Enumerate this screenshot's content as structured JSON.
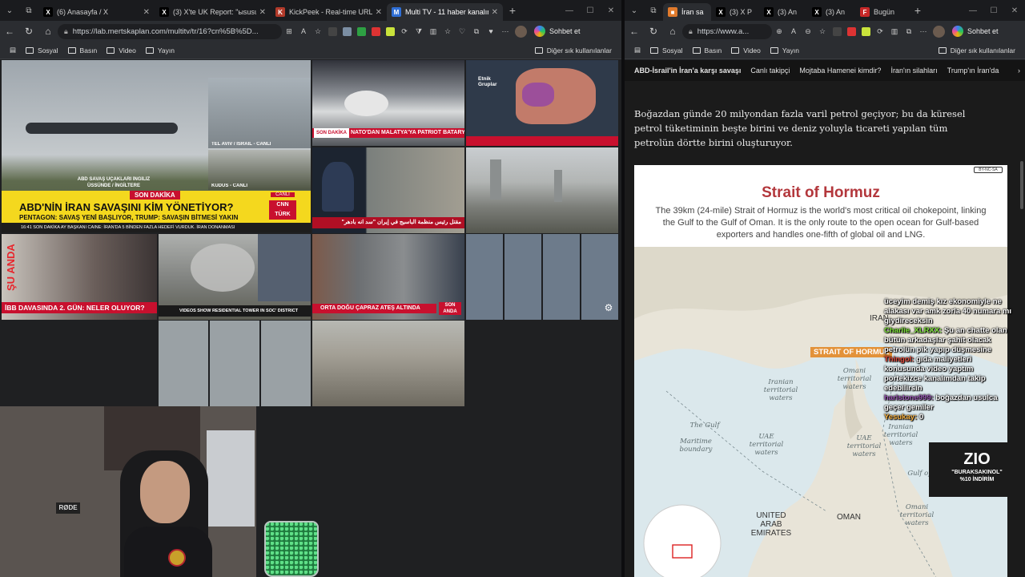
{
  "left_window": {
    "tabs": [
      {
        "label": "(6) Anasayfa / X",
        "favicon": "X",
        "favicon_color": "#000000"
      },
      {
        "label": "(3) X'te UK Report: \"ыsusu. — A",
        "favicon": "X",
        "favicon_color": "#000000"
      },
      {
        "label": "KickPeek - Real-time URL Cra",
        "favicon": "K",
        "favicon_color": "#b23a2a"
      },
      {
        "label": "Multi TV - 11 haber kanalını aynı",
        "favicon": "M",
        "favicon_color": "#2f6fd6",
        "active": true
      }
    ],
    "url": "https://lab.mertskaplan.com/multitv/tr/16?cn%5B%5D...",
    "bookmarks": [
      "Sosyal",
      "Basın",
      "Video",
      "Yayın"
    ],
    "bookmarks_right": "Diğer sık kullanılanlar",
    "tiles": {
      "t1_caption": "ABD SAVAŞ UÇAKLARI İNGİLİZ ÜSSÜNDE / İNGİLTERE",
      "t1_small1": "TEL AVIV / İSRAİL - CANLI",
      "t1_small2": "KUDÜS - CANLI",
      "son_dakika": "SON DAKİKA",
      "headline": "ABD'NİN İRAN SAVAŞINI KİM YÖNETİYOR?",
      "subheadline": "PENTAGON: SAVAŞ YENİ BAŞLIYOR, TRUMP: SAVAŞIN BİTMESİ YAKIN",
      "ticker": "16:41  SON DAKİKA    AY BAŞKANI CAINE: İRAN'DA 5 BİNDEN FAZLA HEDEFİ VURDUK. İRAN DONANMASI",
      "cnn_live": "CANLI",
      "cnn_logo": "CNN TÜRK",
      "ntv_banner": "NATO'DAN MALATYA'YA PATRIOT BATARYASI",
      "ntv_son": "SON DAKİKA",
      "ntv_map_label": "Etnik Gruplar",
      "arabic_caption": "مقتل رئيس منظمة الباسيج في إيران \"سد انه بادهر\"",
      "su_anda": "ŞU ANDA",
      "ibb_caption": "İBB DAVASINDA 2. GÜN: NELER OLUYOR?",
      "aljazeera_caption": "VIDEOS SHOW RESIDENTIAL TOWER IN SOC' DISTRICT",
      "ortadogu_caption": "ORTA DOĞU ÇAPRAZ ATEŞ ALTINDA",
      "son_anda": "SON ANDA"
    }
  },
  "right_window": {
    "tabs": [
      {
        "label": "İran sa",
        "favicon": "■",
        "favicon_color": "#e07a2c",
        "active": true
      },
      {
        "label": "(3) X P",
        "favicon": "X",
        "favicon_color": "#000000"
      },
      {
        "label": "(3) An",
        "favicon": "X",
        "favicon_color": "#000000"
      },
      {
        "label": "(3) An",
        "favicon": "X",
        "favicon_color": "#000000"
      },
      {
        "label": "Bugün",
        "favicon": "F",
        "favicon_color": "#c62828"
      }
    ],
    "url": "https://www.a...",
    "bookmarks": [
      "Sosyal",
      "Basın",
      "Video",
      "Yayın"
    ],
    "bookmarks_right": "Diğer sık kullanılanlar",
    "nav": [
      "ABD-İsrail'in İran'a karşı savaşı",
      "Canlı takipçi",
      "Mojtaba Hamenei kimdir?",
      "İran'ın silahları",
      "Trump'ın İran'da"
    ],
    "paragraph": "Boğazdan günde 20 milyondan fazla varil petrol geçiyor; bu da küresel petrol tüketiminin beşte birini ve deniz yoluyla ticareti yapılan tüm petrolün dörtte birini oluşturuyor.",
    "map": {
      "title": "Strait of Hormuz",
      "subtitle": "The 39km (24-mile) Strait of Hormuz is the world's most critical oil chokepoint, linking the Gulf to the Gulf of Oman. It is the only route to the open ocean for Gulf-based exporters and handles one-fifth of global oil and LNG.",
      "license": "BY-NC-SA",
      "labels": {
        "iran": "IRAN",
        "strait": "STRAIT OF HORMUZ",
        "iranian_waters": "Iranian territorial waters",
        "omani_waters_top": "Omani territorial waters",
        "the_gulf": "The Gulf",
        "maritime": "Maritime boundary",
        "uae_waters": "UAE territorial waters",
        "iranian_waters_2": "Iranian territorial waters",
        "uae_waters_2": "UAE territorial waters",
        "gulf_of_oman": "Gulf of Oman",
        "uae": "UNITED ARAB EMIRATES",
        "oman": "OMAN",
        "omani_waters": "Omani territorial waters"
      }
    },
    "chat": [
      {
        "user": "",
        "text": "üceyim demiş kız ekonomiyle ne alakası var amk zorla 40 numara mı giydireceksin"
      },
      {
        "user": "Charlie_XLRXX:",
        "text": "Şu an chatte olan bütün arkadaşlar şahit olacak petrolün pik yapıp düşmesine"
      },
      {
        "user": "Thingol:",
        "text": "gıda maliyetleri konusunda video yaptım portekizce kanalımdan takip edebilirsin"
      },
      {
        "user": "harlstone999:",
        "text": "boğazdan usulca geçer gemiler"
      },
      {
        "user": "Yesukay:",
        "text": "0"
      }
    ],
    "overlay_logo": {
      "brand": "ZIO",
      "line1": "\"BURAKSAKINOL\"",
      "line2": "%10 İNDİRİM"
    }
  },
  "colors": {
    "red": "#c8102e",
    "accent": "#2f6fd6",
    "strait_orange": "#e3923a",
    "map_title": "#b3373c"
  }
}
